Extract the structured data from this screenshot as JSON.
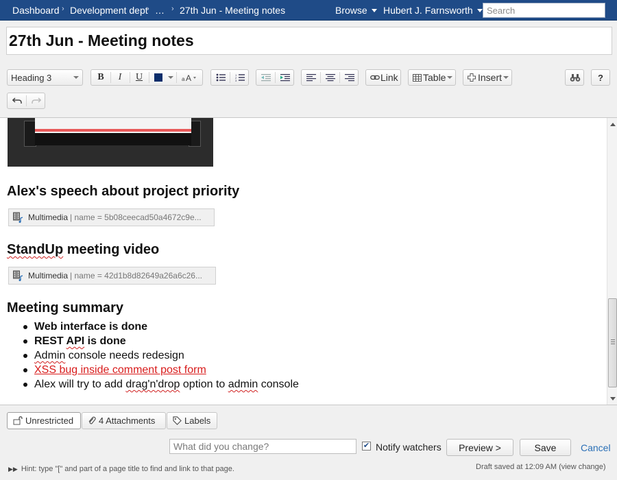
{
  "nav": {
    "breadcrumbs": [
      "Dashboard",
      "Development dept",
      "…",
      "27th Jun - Meeting notes"
    ],
    "browse_label": "Browse",
    "user_label": "Hubert J. Farnsworth",
    "search_placeholder": "Search"
  },
  "page": {
    "title_value": "27th Jun - Meeting notes"
  },
  "toolbar": {
    "style_select": "Heading 3",
    "bold_label": "B",
    "italic_label": "I",
    "underline_label": "U",
    "text_color": "#0b2d6b",
    "link_label": "Link",
    "table_label": "Table",
    "insert_label": "Insert",
    "help_label": "?",
    "icons": [
      "bold-icon",
      "italic-icon",
      "underline-icon",
      "text-color-icon",
      "text-size-icon",
      "bullet-list-icon",
      "numbered-list-icon",
      "outdent-icon",
      "indent-icon",
      "align-left-icon",
      "align-center-icon",
      "align-right-icon",
      "link-icon",
      "table-icon",
      "insert-icon",
      "find-replace-icon",
      "help-icon",
      "undo-icon",
      "redo-icon"
    ]
  },
  "content": {
    "heading_speech": "Alex's speech about project priority",
    "macro1": {
      "label": "Multimedia",
      "meta": "| name = 5b08ceecad50a4672c9e..."
    },
    "heading_video_word": "StandUp",
    "heading_video_rest": " meeting video",
    "macro2": {
      "label": "Multimedia",
      "meta": "| name = 42d1b8d82649a26a6c26..."
    },
    "heading_summary": "Meeting summary",
    "summary": {
      "item1": "Web interface is done",
      "item2_a": "REST ",
      "item2_b": "API",
      "item2_c": " is done",
      "item3_a": "Admin",
      "item3_b": " console needs redesign",
      "item4": "XSS bug inside comment post form",
      "item5_a": "Alex will try to add ",
      "item5_b": "drag'n'drop",
      "item5_c": " option to ",
      "item5_d": "admin",
      "item5_e": " console"
    }
  },
  "footer": {
    "restrictions_label": "Unrestricted",
    "attachments_label": "4 Attachments",
    "labels_label": "Labels",
    "change_placeholder": "What did you change?",
    "notify_label": "Notify watchers",
    "notify_checked": true,
    "preview_label": "Preview >",
    "save_label": "Save",
    "cancel_label": "Cancel",
    "hint_text": "Hint: type \"[\" and part of a page title to find and link to that page.",
    "draft_text": "Draft saved at 12:09 AM (view change)"
  },
  "colors": {
    "topbar": "#1f4b87",
    "accent_link": "#2a6fb6",
    "error_red": "#d81b1b"
  }
}
